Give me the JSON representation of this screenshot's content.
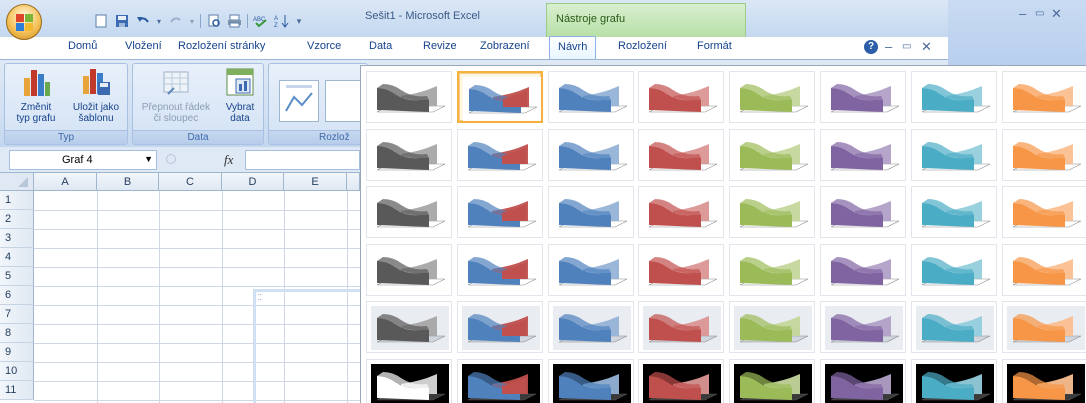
{
  "app": {
    "title": "Sešit1 - Microsoft Excel",
    "contextual_tab_group": "Nástroje grafu"
  },
  "tabs": [
    "Domů",
    "Vložení",
    "Rozložení stránky",
    "Vzorce",
    "Data",
    "Revize",
    "Zobrazení",
    "Návrh",
    "Rozložení",
    "Formát"
  ],
  "active_tab": "Návrh",
  "ribbon": {
    "groups": [
      {
        "label": "Typ",
        "buttons": [
          "Změnit\ntyp grafu",
          "Uložit jako\nšablonu"
        ]
      },
      {
        "label": "Data",
        "buttons": [
          "Přepnout řádek\nči sloupec",
          "Vybrat\ndata"
        ]
      },
      {
        "label": "Rozlož",
        "buttons": []
      }
    ]
  },
  "formula_bar": {
    "name_box": "Graf 4",
    "fx_label": "fx"
  },
  "sheet": {
    "columns": [
      "A",
      "B",
      "C",
      "D",
      "E"
    ],
    "rows": [
      "1",
      "2",
      "3",
      "4",
      "5",
      "6",
      "7",
      "8",
      "9",
      "10",
      "11"
    ]
  },
  "chart_style_gallery": {
    "rows": 6,
    "columns": 8,
    "selected": {
      "row": 0,
      "column": 1
    },
    "palette": [
      {
        "name": "grayscale",
        "main": "#595959",
        "accent": "#a6a6a6"
      },
      {
        "name": "blue-multicolor",
        "main": "#4f81bd",
        "accent": "#c0504d"
      },
      {
        "name": "blue",
        "main": "#4f81bd",
        "accent": "#95b3d7"
      },
      {
        "name": "red",
        "main": "#c0504d",
        "accent": "#da9694"
      },
      {
        "name": "green",
        "main": "#9bbb59",
        "accent": "#c4d79b"
      },
      {
        "name": "purple",
        "main": "#8064a2",
        "accent": "#b1a0c7"
      },
      {
        "name": "aqua",
        "main": "#4bacc6",
        "accent": "#92cddc"
      },
      {
        "name": "orange",
        "main": "#f79646",
        "accent": "#fabf8f"
      }
    ],
    "row_backgrounds": [
      "#ffffff",
      "#ffffff",
      "#ffffff",
      "#ffffff",
      "#e9ecf1",
      "#000000"
    ]
  }
}
